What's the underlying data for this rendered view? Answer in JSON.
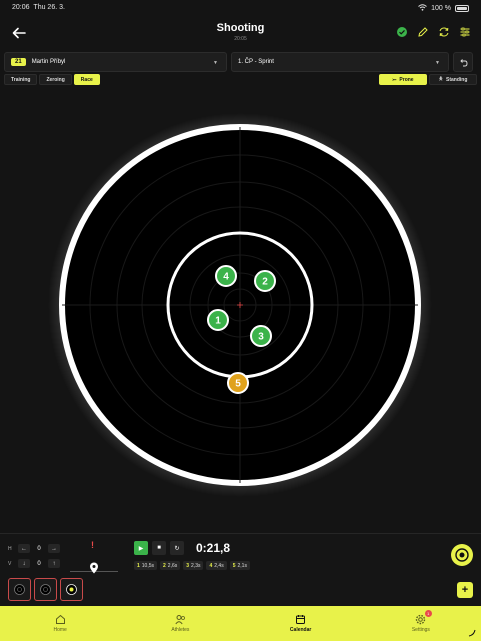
{
  "status_bar": {
    "time": "20:06",
    "date": "Thu 26. 3.",
    "battery": "100 %"
  },
  "header": {
    "title": "Shooting",
    "subtitle": "20:05"
  },
  "athlete": {
    "bib": "21",
    "name": "Martin Příbyl"
  },
  "race": {
    "name": "1. ČP - Sprint"
  },
  "mode_tabs": [
    "Training",
    "Zeroing",
    "Race"
  ],
  "active_mode": "Race",
  "positions": [
    {
      "label": "Prone",
      "icon": "prone-icon",
      "active": true
    },
    {
      "label": "Standing",
      "icon": "standing-icon",
      "active": false
    }
  ],
  "shots": [
    {
      "label": "1",
      "color": "#3bb34a"
    },
    {
      "label": "2",
      "color": "#3bb34a"
    },
    {
      "label": "3",
      "color": "#3bb34a"
    },
    {
      "label": "4",
      "color": "#3bb34a"
    },
    {
      "label": "5",
      "color": "#e0a21c"
    }
  ],
  "correction": {
    "h_label": "H",
    "h_value": "0",
    "v_label": "V",
    "v_value": "0"
  },
  "warning": "!",
  "timer": "0:21,8",
  "splits": [
    {
      "n": "1",
      "t": "10,5s"
    },
    {
      "n": "2",
      "t": "2,6s"
    },
    {
      "n": "3",
      "t": "2,3s"
    },
    {
      "n": "4",
      "t": "2,4s"
    },
    {
      "n": "5",
      "t": "2,1s"
    }
  ],
  "nav": [
    {
      "label": "Home",
      "icon": "home-icon"
    },
    {
      "label": "Athletes",
      "icon": "athletes-icon"
    },
    {
      "label": "Calendar",
      "icon": "calendar-icon",
      "active": true
    },
    {
      "label": "Settings",
      "icon": "gear-icon",
      "badge": "1"
    }
  ],
  "colors": {
    "accent": "#e8f24a",
    "hit": "#3bb34a",
    "miss": "#e0a21c",
    "background": "#141414"
  }
}
